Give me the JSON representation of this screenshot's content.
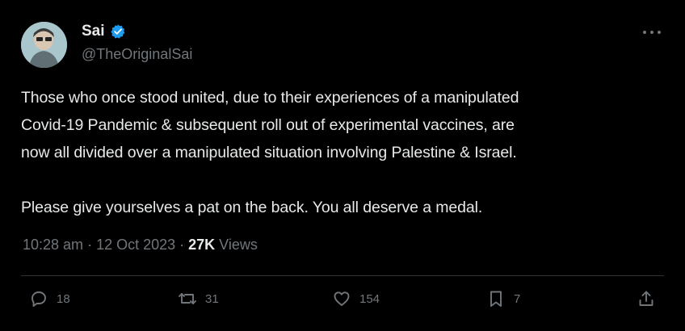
{
  "author": {
    "display_name": "Sai",
    "handle": "@TheOriginalSai",
    "verified_icon": "verified-badge-icon",
    "avatar_icon": "avatar-image"
  },
  "tweet": {
    "lines": [
      "Those who once stood united, due to their experiences of a manipulated",
      "Covid-19 Pandemic & subsequent roll out of experimental vaccines, are",
      "now all divided over a manipulated situation involving Palestine & Israel.",
      "Please give yourselves a pat on the back. You all deserve a medal."
    ]
  },
  "meta": {
    "time": "10:28 am",
    "separator": "·",
    "date": "12 Oct 2023",
    "views_count": "27K",
    "views_label": "Views"
  },
  "actions": {
    "replies": "18",
    "reposts": "31",
    "likes": "154",
    "bookmarks": "7"
  },
  "colors": {
    "background": "#000000",
    "text": "#e7e9ea",
    "muted": "#71767b",
    "verified": "#1d9bf0",
    "divider": "#2f3336"
  }
}
